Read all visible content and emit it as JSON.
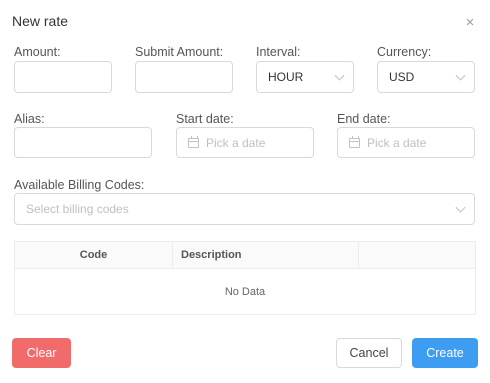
{
  "dialog": {
    "title": "New rate",
    "close_icon": "×"
  },
  "fields": {
    "amount": {
      "label": "Amount:",
      "value": ""
    },
    "submit_amount": {
      "label": "Submit Amount:",
      "value": ""
    },
    "interval": {
      "label": "Interval:",
      "value": "HOUR"
    },
    "currency": {
      "label": "Currency:",
      "value": "USD"
    },
    "alias": {
      "label": "Alias:",
      "value": ""
    },
    "start_date": {
      "label": "Start date:",
      "placeholder": "Pick a date"
    },
    "end_date": {
      "label": "End date:",
      "placeholder": "Pick a date"
    },
    "billing_codes": {
      "label": "Available Billing Codes:",
      "placeholder": "Select billing codes"
    }
  },
  "table": {
    "columns": [
      "Code",
      "Description",
      ""
    ],
    "empty_text": "No Data"
  },
  "buttons": {
    "clear": "Clear",
    "cancel": "Cancel",
    "create": "Create"
  },
  "colors": {
    "clear": "#f26b6b",
    "create": "#3d9df0"
  }
}
